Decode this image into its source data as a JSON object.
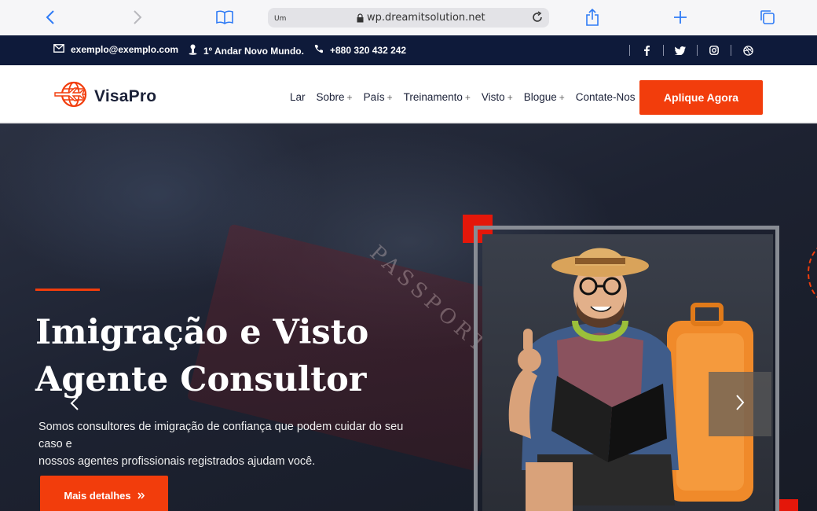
{
  "browser": {
    "url_prefix": "Um",
    "url": "wp.dreamitsolution.net"
  },
  "topbar": {
    "email": "exemplo@exemplo.com",
    "address": "1º Andar Novo Mundo.",
    "phone": "+880 320 432 242",
    "social": [
      "facebook",
      "twitter",
      "instagram",
      "dribbble"
    ]
  },
  "header": {
    "logo": "VisaPro",
    "menu": [
      {
        "label": "Lar",
        "dropdown": false
      },
      {
        "label": "Sobre",
        "dropdown": true
      },
      {
        "label": "País",
        "dropdown": true
      },
      {
        "label": "Treinamento",
        "dropdown": true
      },
      {
        "label": "Visto",
        "dropdown": true
      },
      {
        "label": "Blogue",
        "dropdown": true
      },
      {
        "label": "Contate-Nos",
        "dropdown": false
      }
    ],
    "cta": "Aplique Agora"
  },
  "hero": {
    "title_line1": "Imigração e Visto",
    "title_line2": "Agente Consultor",
    "desc_line1": "Somos consultores de imigração de confiança que podem cuidar do seu",
    "desc_line2": "caso e",
    "desc_line3": "nossos agentes profissionais registrados ajudam você.",
    "button": "Mais detalhes",
    "background_text": "PASSPORT"
  },
  "colors": {
    "accent": "#f23d0c",
    "navy": "#0e1a3a",
    "text": "#1b2138"
  }
}
